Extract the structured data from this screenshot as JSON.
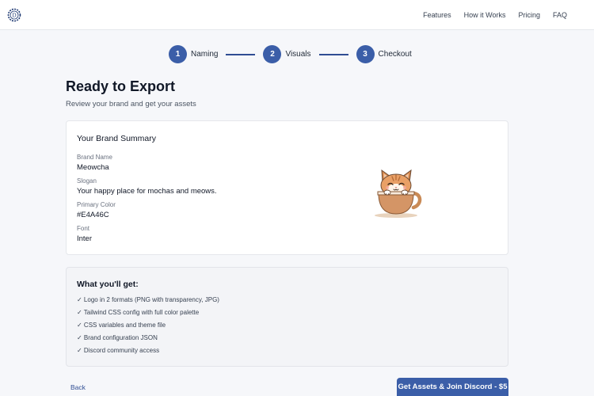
{
  "nav": {
    "links": [
      "Features",
      "How it Works",
      "Pricing",
      "FAQ"
    ]
  },
  "stepper": {
    "steps": [
      {
        "number": "1",
        "label": "Naming"
      },
      {
        "number": "2",
        "label": "Visuals"
      },
      {
        "number": "3",
        "label": "Checkout"
      }
    ]
  },
  "page": {
    "title": "Ready to Export",
    "subtitle": "Review your brand and get your assets"
  },
  "summary": {
    "title": "Your Brand Summary",
    "fields": [
      {
        "label": "Brand Name",
        "value": "Meowcha"
      },
      {
        "label": "Slogan",
        "value": "Your happy place for mochas and meows."
      },
      {
        "label": "Primary Color",
        "value": "#E4A46C"
      },
      {
        "label": "Font",
        "value": "Inter"
      }
    ],
    "mascot_icon": "cat-in-coffee-cup-icon"
  },
  "deliverables": {
    "title": "What you'll get:",
    "items": [
      "✓ Logo in 2 formats (PNG with transparency, JPG)",
      "✓ Tailwind CSS config with full color palette",
      "✓ CSS variables and theme file",
      "✓ Brand configuration JSON",
      "✓ Discord community access"
    ]
  },
  "actions": {
    "back_label": "Back",
    "cta_label": "Get Assets & Join Discord - $5"
  },
  "colors": {
    "accent": "#3b5ea8",
    "accent_dark": "#2f4d93",
    "brand_primary": "#E4A46C"
  }
}
